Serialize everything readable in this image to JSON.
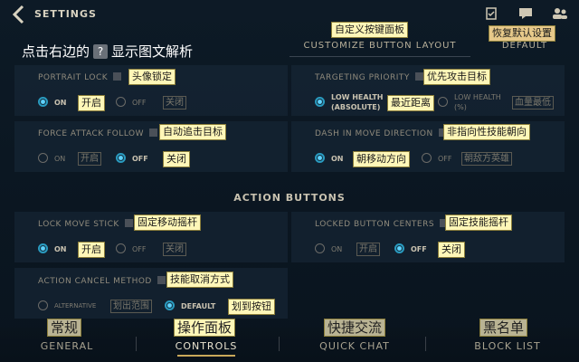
{
  "header": {
    "title": "SETTINGS",
    "customize_tab": "CUSTOMIZE BUTTON LAYOUT",
    "customize_note": "自定义按键面板",
    "default_tab": "DEFAULT",
    "default_note": "恢复默认设置"
  },
  "hint": {
    "before": "点击右边的",
    "qmark": "?",
    "after": "显示图文解析"
  },
  "portrait_lock": {
    "label": "PORTRAIT LOCK",
    "note": "头像锁定",
    "on": "ON",
    "off": "OFF",
    "on_note": "开启",
    "off_note": "关闭"
  },
  "targeting_priority": {
    "label": "TARGETING PRIORITY",
    "note": "优先攻击目标",
    "opt1": "LOW HEALTH",
    "opt1b": "(ABSOLUTE)",
    "opt1_note": "最近距离",
    "opt2": "LOW HEALTH",
    "opt2b": "(%)",
    "opt2_note": "血量最低"
  },
  "force_attack": {
    "label": "FORCE ATTACK FOLLOW",
    "note": "自动追击目标",
    "on": "ON",
    "off": "OFF",
    "on_note": "开启",
    "off_note": "关闭"
  },
  "dash_direction": {
    "label": "DASH IN MOVE DIRECTION",
    "note": "非指向性技能朝向",
    "on": "ON",
    "off": "OFF",
    "on_note": "朝移动方向",
    "off_note": "朝敌方英雄"
  },
  "section_title": "ACTION BUTTONS",
  "lock_move_stick": {
    "label": "LOCK MOVE STICK",
    "note": "固定移动摇杆",
    "on": "ON",
    "off": "OFF",
    "on_note": "开启",
    "off_note": "关闭"
  },
  "locked_centers": {
    "label": "LOCKED BUTTON CENTERS",
    "note": "固定技能摇杆",
    "on": "ON",
    "off": "OFF",
    "on_note": "开启",
    "off_note": "关闭"
  },
  "cancel_method": {
    "label": "ACTION CANCEL METHOD",
    "note": "技能取消方式",
    "alt": "ALTERNATIVE",
    "alt_note": "划出范围",
    "def": "DEFAULT",
    "def_note": "划到按钮"
  },
  "tabs": {
    "general": "GENERAL",
    "general_note": "常规",
    "controls": "CONTROLS",
    "controls_note": "操作面板",
    "quick_chat": "QUICK CHAT",
    "quick_chat_note": "快捷交流",
    "block_list": "BLOCK LIST",
    "block_list_note": "黑名单"
  },
  "icons": [
    "back-chevron-icon",
    "mission-icon",
    "chat-icon",
    "friends-icon"
  ],
  "colors": {
    "accent": "#2a9bc0",
    "annotation": "#fff7b8"
  }
}
